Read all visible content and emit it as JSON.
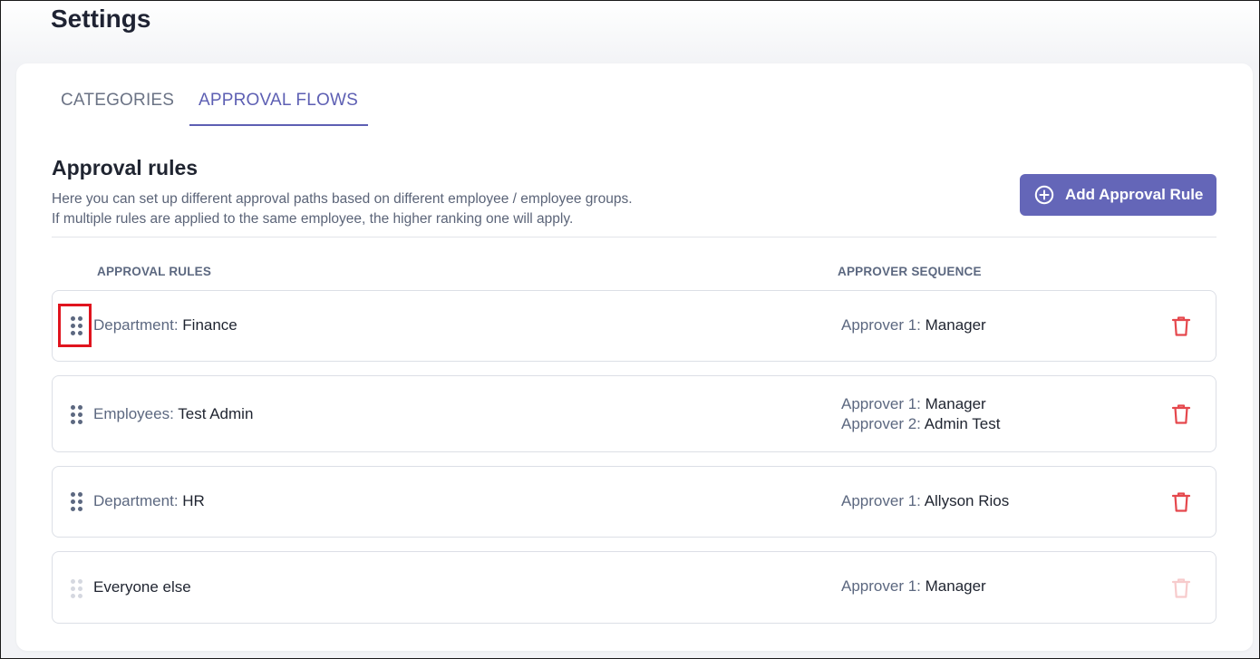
{
  "page": {
    "title": "Settings"
  },
  "tabs": [
    {
      "label": "CATEGORIES",
      "active": false
    },
    {
      "label": "APPROVAL FLOWS",
      "active": true
    }
  ],
  "section": {
    "title": "Approval rules",
    "description_line1": "Here you can set up different approval paths based on different employee / employee groups.",
    "description_line2": "If multiple rules are applied to the same employee, the higher ranking one will apply.",
    "add_button_label": "Add Approval Rule"
  },
  "table": {
    "col_rules": "APPROVAL RULES",
    "col_sequence": "APPROVER SEQUENCE",
    "rows": [
      {
        "rule_key": "Department:",
        "rule_value": "Finance",
        "approvers": [
          {
            "key": "Approver 1:",
            "value": "Manager"
          }
        ]
      },
      {
        "rule_key": "Employees:",
        "rule_value": "Test Admin",
        "approvers": [
          {
            "key": "Approver 1:",
            "value": "Manager"
          },
          {
            "key": "Approver 2:",
            "value": "Admin Test"
          }
        ]
      },
      {
        "rule_key": "Department:",
        "rule_value": "HR",
        "approvers": [
          {
            "key": "Approver 1:",
            "value": "Allyson Rios"
          }
        ]
      },
      {
        "rule_key": "",
        "rule_value": "Everyone else",
        "approvers": [
          {
            "key": "Approver 1:",
            "value": "Manager"
          }
        ]
      }
    ]
  },
  "colors": {
    "accent": "#6466b8",
    "delete": "#e5484d",
    "highlight": "#e0141e"
  },
  "icons": {
    "add": "plus-circle-icon",
    "drag": "drag-handle-icon",
    "delete": "trash-icon"
  }
}
